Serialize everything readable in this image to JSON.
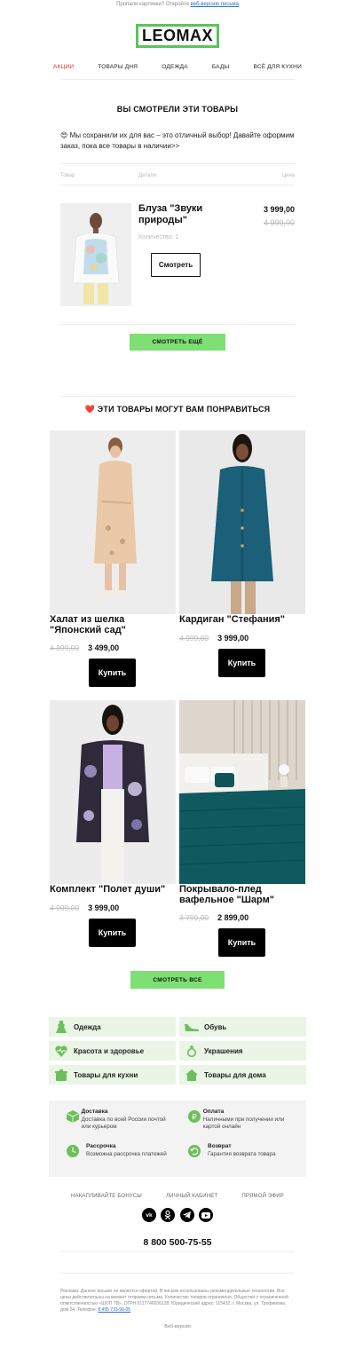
{
  "preheader": {
    "text": "Пропали картинки? Откройте",
    "link": "веб-версию письма"
  },
  "brand": {
    "logo": "LEOMAX",
    "accent": "#5cc35a"
  },
  "nav": [
    "АКЦИИ",
    "ТОВАРЫ ДНЯ",
    "ОДЕЖДА",
    "БАДЫ",
    "ВСЁ ДЛЯ КУХНИ"
  ],
  "viewed": {
    "title": "ВЫ СМОТРЕЛИ ЭТИ ТОВАРЫ",
    "intro_emoji": "😍",
    "intro": "Мы сохранили их для вас – это отличный выбор! Давайте оформим заказ, пока все товары в наличии>>",
    "columns": [
      "Товар",
      "Детали",
      "Цена"
    ],
    "product": {
      "name": "Блуза \"Звуки природы\"",
      "price": "3 999,00",
      "old_price": "4 999,00",
      "qty": "Количество: 1",
      "button": "Смотреть"
    },
    "more_button": "СМОТРЕТЬ ЕЩЁ"
  },
  "recommend": {
    "title": "ЭТИ ТОВАРЫ МОГУТ ВАМ ПОНРАВИТЬСЯ",
    "heart": "❤️",
    "items": [
      {
        "name": "Халат из шелка \"Японский сад\"",
        "old": "4 399,00",
        "price": "3 499,00",
        "button": "Купить"
      },
      {
        "name": "Кардиган \"Стефания\"",
        "old": "4 999,00",
        "price": "3 999,00",
        "button": "Купить"
      },
      {
        "name": "Комплект \"Полет души\"",
        "old": "4 999,00",
        "price": "3 999,00",
        "button": "Купить"
      },
      {
        "name": "Покрывало-плед вафельное \"Шарм\"",
        "old": "3 799,00",
        "price": "2 899,00",
        "button": "Купить"
      }
    ],
    "all_button": "СМОТРЕТЬ ВСЕ"
  },
  "categories": [
    {
      "label": "Одежда",
      "icon": "dress-icon"
    },
    {
      "label": "Обувь",
      "icon": "shoe-icon"
    },
    {
      "label": "Красота и здоровье",
      "icon": "heart-pulse-icon"
    },
    {
      "label": "Украшения",
      "icon": "ring-icon"
    },
    {
      "label": "Товары для кухни",
      "icon": "pot-icon"
    },
    {
      "label": "Товары для дома",
      "icon": "house-icon"
    }
  ],
  "info": [
    {
      "title": "Доставка",
      "text": "Доставка по всей России почтой или курьером",
      "icon": "box-icon"
    },
    {
      "title": "Оплата",
      "text": "Наличными при получении или картой онлайн",
      "icon": "ruble-icon"
    },
    {
      "title": "Рассрочка",
      "text": "Возможна рассрочка платежей",
      "icon": "clock-icon"
    },
    {
      "title": "Возврат",
      "text": "Гарантия возврата товара",
      "icon": "return-icon"
    }
  ],
  "footer": {
    "links": [
      "НАКАПЛИВАЙТЕ БОНУСЫ",
      "ЛИЧНЫЙ КАБИНЕТ",
      "ПРЯМОЙ ЭФИР"
    ],
    "socials": [
      "vk-icon",
      "ok-icon",
      "telegram-icon",
      "youtube-icon"
    ],
    "phone": "8 800 500-75-55",
    "legal": "Реклама. Данное письмо не является офертой. В письме использованы рекомендательные технологии. Все цены действительны на момент отправки письма. Количество товаров ограничено. Общество с ограниченной ответственностью «ШОП ТВ». ОГРН 5117746036128. Юридический адрес: 115432, г. Москва, ул. Трофимова, дом 24. Телефон:",
    "legal_phone": "8 495 733-96-05",
    "web_version": "Веб-версия"
  },
  "colors": {
    "green": "#7ddf74",
    "green_light": "#eaf5e6",
    "sale": "#d43030"
  }
}
